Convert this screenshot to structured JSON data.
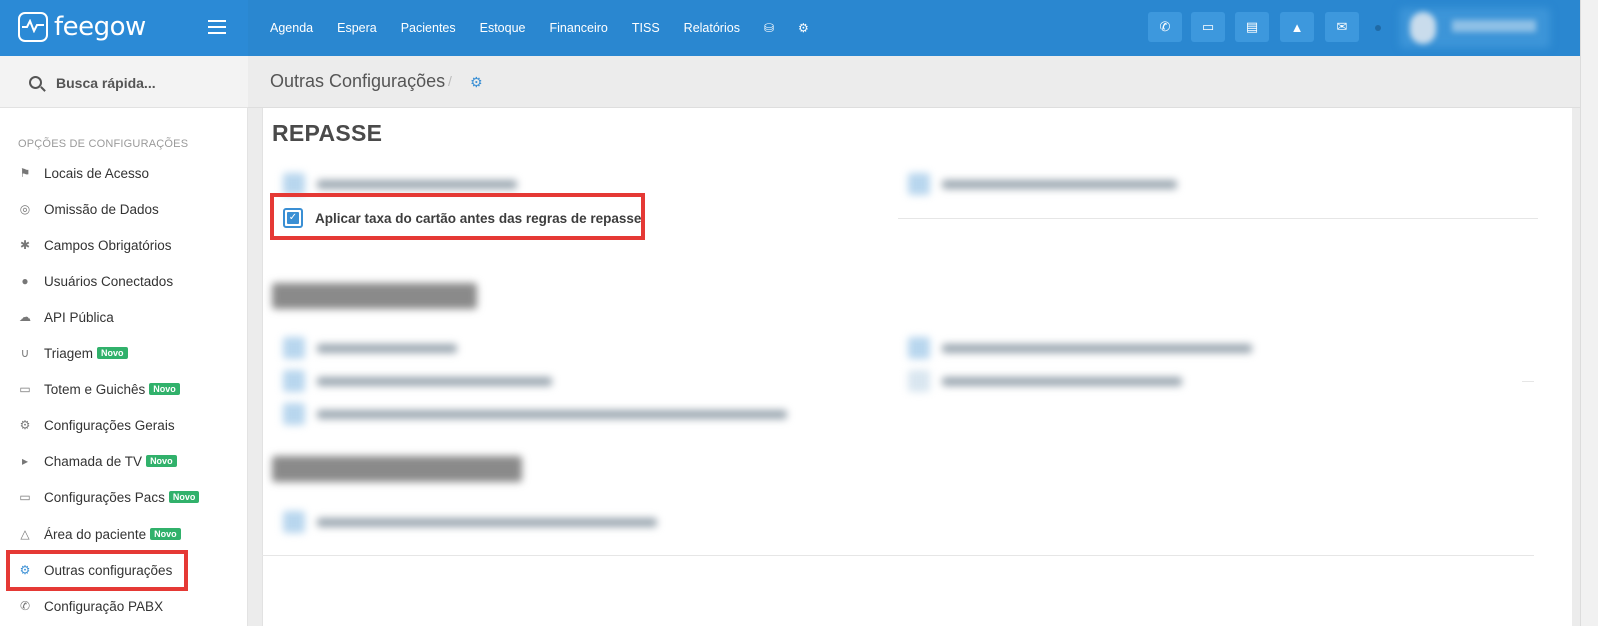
{
  "brand": {
    "logo_text": "feegow"
  },
  "topnav": {
    "items": [
      "Agenda",
      "Espera",
      "Pacientes",
      "Estoque",
      "Financeiro",
      "TISS",
      "Relatórios"
    ],
    "extra_icons": [
      "database-icon",
      "gear-icon"
    ]
  },
  "toolbar": {
    "icons": [
      "phone-icon",
      "inbox-icon",
      "card-icon",
      "bell-icon",
      "chat-icon"
    ]
  },
  "search": {
    "placeholder": "Busca rápida..."
  },
  "sidebar": {
    "heading": "OPÇÕES DE CONFIGURAÇÕES",
    "badge_label": "Novo",
    "items": [
      {
        "label": "Locais de Acesso",
        "icon": "map-pin-icon"
      },
      {
        "label": "Omissão de Dados",
        "icon": "eye-slash-icon"
      },
      {
        "label": "Campos Obrigatórios",
        "icon": "asterisk-icon"
      },
      {
        "label": "Usuários Conectados",
        "icon": "user-icon"
      },
      {
        "label": "API Pública",
        "icon": "cloud-icon"
      },
      {
        "label": "Triagem",
        "icon": "stethoscope-icon",
        "badge": true
      },
      {
        "label": "Totem e Guichês",
        "icon": "laptop-icon",
        "badge": true
      },
      {
        "label": "Configurações Gerais",
        "icon": "gears-icon"
      },
      {
        "label": "Chamada de TV",
        "icon": "bullhorn-icon",
        "badge": true
      },
      {
        "label": "Configurações Pacs",
        "icon": "laptop-icon",
        "badge": true
      },
      {
        "label": "Área do paciente",
        "icon": "flask-icon",
        "badge": true
      },
      {
        "label": "Outras configurações",
        "icon": "gears-icon",
        "active": true
      },
      {
        "label": "Configuração PABX",
        "icon": "phone-icon"
      }
    ]
  },
  "breadcrumb": {
    "title": "Outras Configurações",
    "separator": "/"
  },
  "content": {
    "section_repasse": "REPASSE",
    "card_fee_checkbox": {
      "label": "Aplicar taxa do cartão antes das regras de repasse",
      "checked": true
    }
  },
  "colors": {
    "topbar": "#2a87d0",
    "accent": "#3a8fd4",
    "highlight": "#e53935",
    "badge": "#31b16b"
  }
}
